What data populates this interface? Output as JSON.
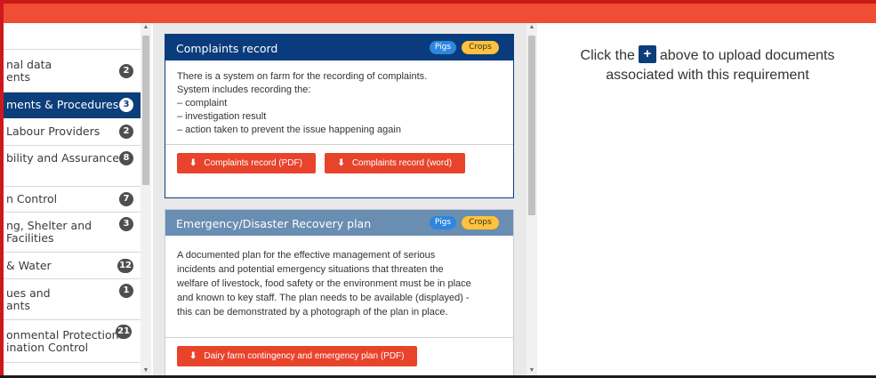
{
  "sidebar": {
    "items": [
      {
        "label": "nal data\nents",
        "badge": "2",
        "active": false
      },
      {
        "label": "ments & Procedures",
        "badge": "3",
        "active": true
      },
      {
        "label": "Labour Providers",
        "badge": "2",
        "active": false
      },
      {
        "label": "bility and Assurance",
        "badge": "8",
        "active": false
      },
      {
        "label": "n Control",
        "badge": "7",
        "active": false
      },
      {
        "label": "ng, Shelter and\nFacilities",
        "badge": "3",
        "active": false
      },
      {
        "label": "& Water",
        "badge": "12",
        "active": false
      },
      {
        "label": "ues and\nants",
        "badge": "1",
        "active": false
      },
      {
        "label": "onmental Protection\nination Control",
        "badge": "21",
        "active": false
      }
    ]
  },
  "cards": [
    {
      "title": "Complaints record",
      "tags": [
        "Pigs",
        "Crops"
      ],
      "body_lines": [
        "There is a system on farm for the recording of complaints.",
        "System includes recording the:",
        "– complaint",
        "– investigation result",
        "– action taken to prevent the issue happening again"
      ],
      "buttons": [
        "Complaints record (PDF)",
        "Complaints record (word)"
      ]
    },
    {
      "title": "Emergency/Disaster Recovery plan",
      "tags": [
        "Pigs",
        "Crops"
      ],
      "body_lines": [
        "A documented plan for the effective management of serious",
        "incidents and potential emergency situations that threaten the",
        "welfare of livestock, food safety or the environment must be in place",
        "and known to key staff. The plan needs to be available (displayed) -",
        "this can be demonstrated by a photograph of the plan in place."
      ],
      "buttons": [
        "Dairy farm contingency and emergency plan (PDF)"
      ]
    }
  ],
  "upload_hint": {
    "before": "Click the",
    "plus": "+",
    "after": "above to upload documents",
    "line2": "associated with this requirement"
  },
  "icons": {
    "download": "download-icon",
    "plus": "plus-icon"
  },
  "colors": {
    "header_red": "#ef4e34",
    "active_navy": "#0b3e7a",
    "button_red": "#e8432b",
    "pigs_blue": "#2e86de",
    "crops_yellow": "#ffc23a"
  }
}
